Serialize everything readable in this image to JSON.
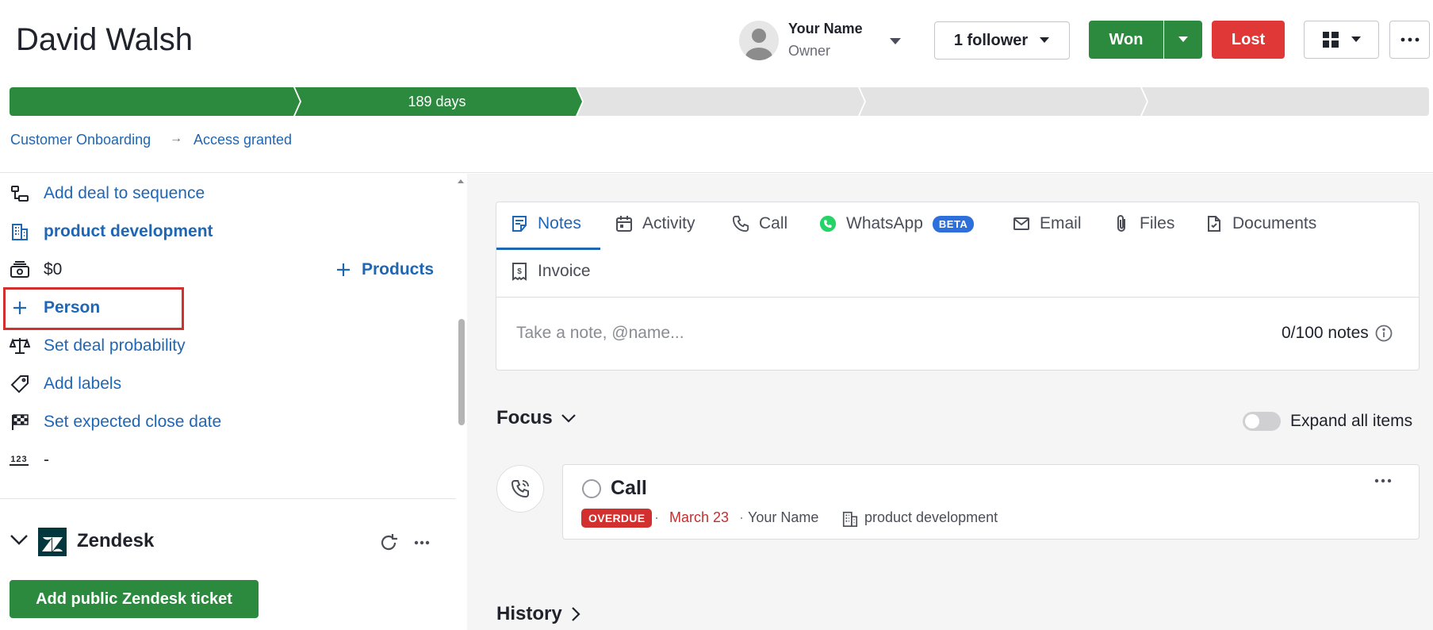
{
  "header": {
    "title": "David Walsh",
    "owner": {
      "name": "Your Name",
      "role": "Owner"
    },
    "follower_button": "1 follower",
    "won_button": "Won",
    "lost_button": "Lost"
  },
  "pipeline": {
    "stages": [
      {
        "label": "",
        "status": "complete"
      },
      {
        "label": "189 days",
        "status": "current"
      },
      {
        "label": "",
        "status": "pending"
      },
      {
        "label": "",
        "status": "pending"
      },
      {
        "label": "",
        "status": "pending"
      }
    ]
  },
  "breadcrumb": {
    "pipeline": "Customer Onboarding",
    "stage": "Access granted"
  },
  "sidebar": {
    "add_sequence": "Add deal to sequence",
    "organization": "product development",
    "value": "$0",
    "products": "Products",
    "person": "Person",
    "probability": "Set deal probability",
    "labels": "Add labels",
    "close_date": "Set expected close date",
    "custom_number": "-",
    "zendesk_title": "Zendesk",
    "zendesk_button": "Add public Zendesk ticket"
  },
  "tabs": {
    "notes": "Notes",
    "activity": "Activity",
    "call": "Call",
    "whatsapp": "WhatsApp",
    "beta": "BETA",
    "email": "Email",
    "files": "Files",
    "documents": "Documents",
    "invoice": "Invoice"
  },
  "composer": {
    "placeholder": "Take a note, @name...",
    "counter": "0/100 notes"
  },
  "focus": {
    "title": "Focus",
    "expand_label": "Expand all items",
    "activity": {
      "title": "Call",
      "badge": "OVERDUE",
      "date": "March 23",
      "assignee": "Your Name",
      "organization": "product development"
    }
  },
  "history": {
    "title": "History"
  },
  "colors": {
    "green": "#2b8a3e",
    "red": "#e03737",
    "link": "#1f66b5",
    "grey_stage": "#e3e3e3"
  },
  "icons": [
    "caret-down-icon",
    "grid-view-icon",
    "more-icon",
    "sequence-icon",
    "building-icon",
    "money-icon",
    "plus-icon",
    "scale-icon",
    "tag-icon",
    "flag-icon",
    "numbers-icon",
    "chevron-down-icon",
    "refresh-icon",
    "note-icon",
    "calendar-icon",
    "phone-icon",
    "whatsapp-icon",
    "mail-icon",
    "paperclip-icon",
    "document-icon",
    "invoice-icon",
    "info-icon",
    "chevron-right-icon",
    "phone-outgoing-icon"
  ]
}
